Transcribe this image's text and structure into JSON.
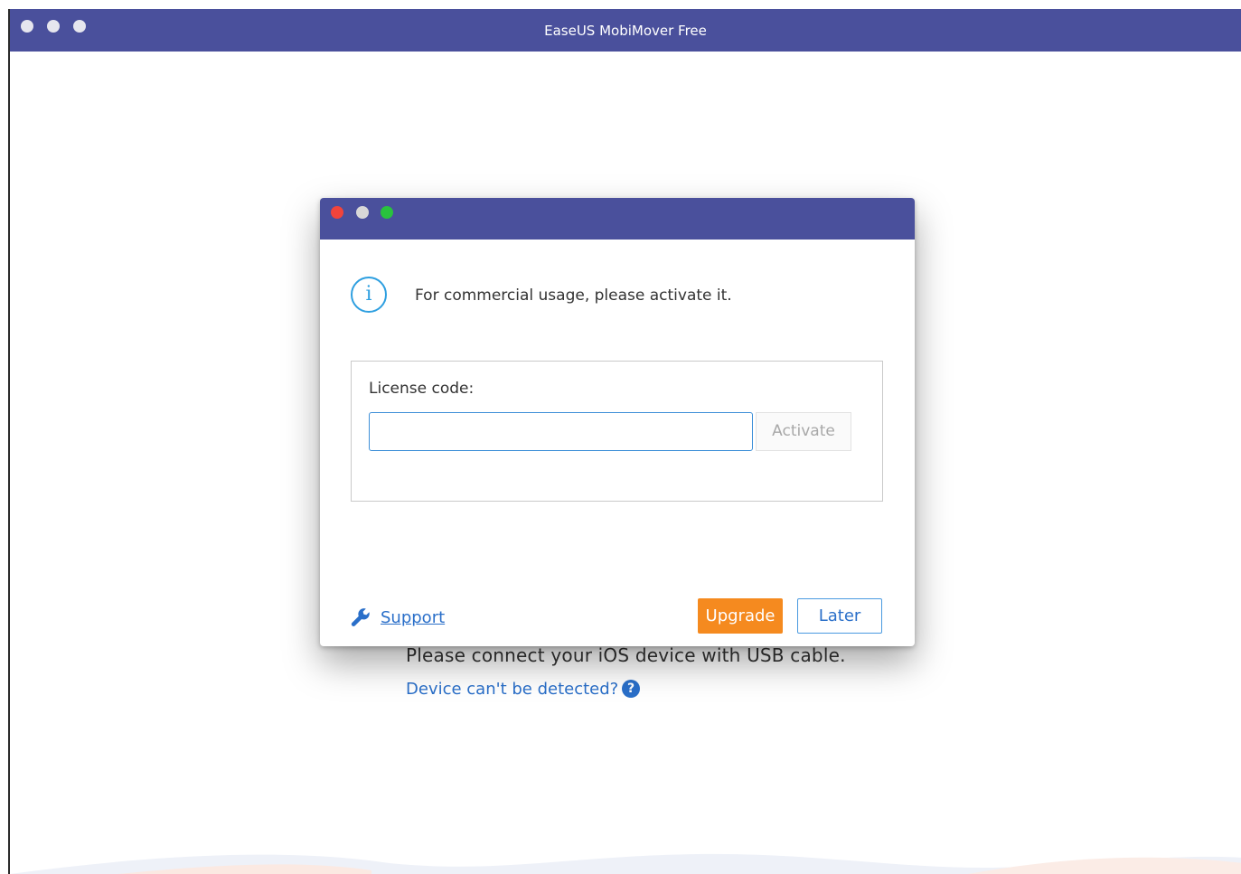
{
  "main_window": {
    "title": "EaseUS MobiMover Free",
    "connect_message": "Please connect your iOS device with USB cable.",
    "detect_link": "Device can't be detected?"
  },
  "dialog": {
    "info_message": "For commercial usage, please activate it.",
    "license_label": "License code:",
    "license_value": "",
    "activate_label": "Activate",
    "support_label": "Support",
    "upgrade_label": "Upgrade",
    "later_label": "Later"
  },
  "colors": {
    "titlebar": "#4a509c",
    "accent_orange": "#f58a1f",
    "link_blue": "#2a6fc9",
    "traffic_close": "#f2443b",
    "traffic_minimize": "#d8d8d8",
    "traffic_zoom": "#29c23e"
  },
  "icons": {
    "info": "info-circle-icon",
    "support": "wrench-icon",
    "help": "question-circle-icon"
  }
}
